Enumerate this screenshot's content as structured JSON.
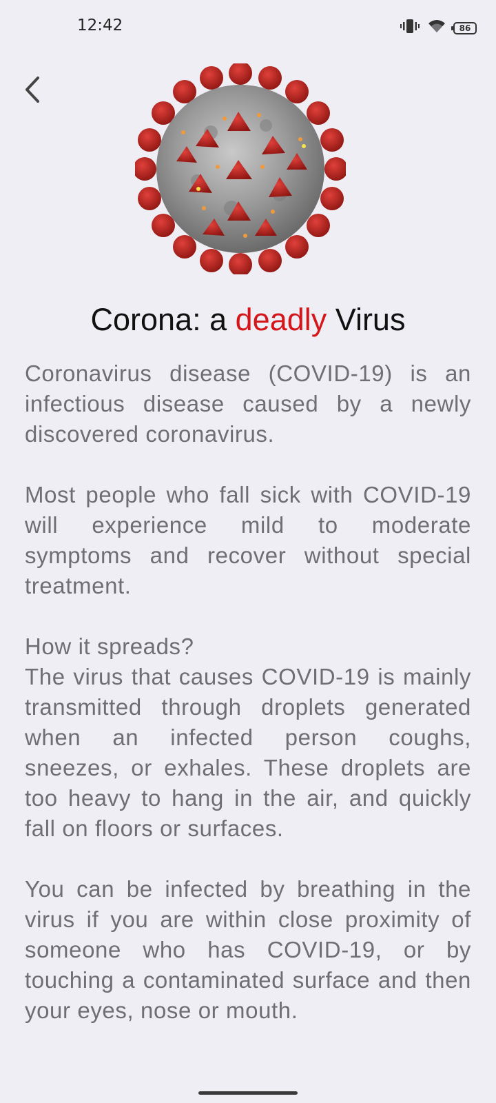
{
  "status_bar": {
    "time": "12:42",
    "battery_level": "86"
  },
  "header": {
    "back_icon": "chevron-left-icon",
    "title_part1": "Corona: a ",
    "title_accent": "deadly",
    "title_part2": " Virus",
    "accent_color": "#d4161b"
  },
  "article": {
    "paragraph1": "Coronavirus disease (COVID-19) is an infectious disease caused by a newly discovered coronavirus.",
    "paragraph2": "Most people who fall sick with COVID-19 will experience mild to moderate symptoms and recover without special treatment.",
    "subheading": "How it spreads?",
    "paragraph3": "The virus that causes COVID-19 is mainly transmitted through droplets generated when an infected person coughs, sneezes, or exhales. These droplets are too heavy to hang in the air, and quickly fall on floors or surfaces.",
    "paragraph4": "You can be infected by breathing in the virus if you are within close proximity of someone who has COVID-19, or by touching a contaminated surface and then your eyes, nose or mouth."
  }
}
